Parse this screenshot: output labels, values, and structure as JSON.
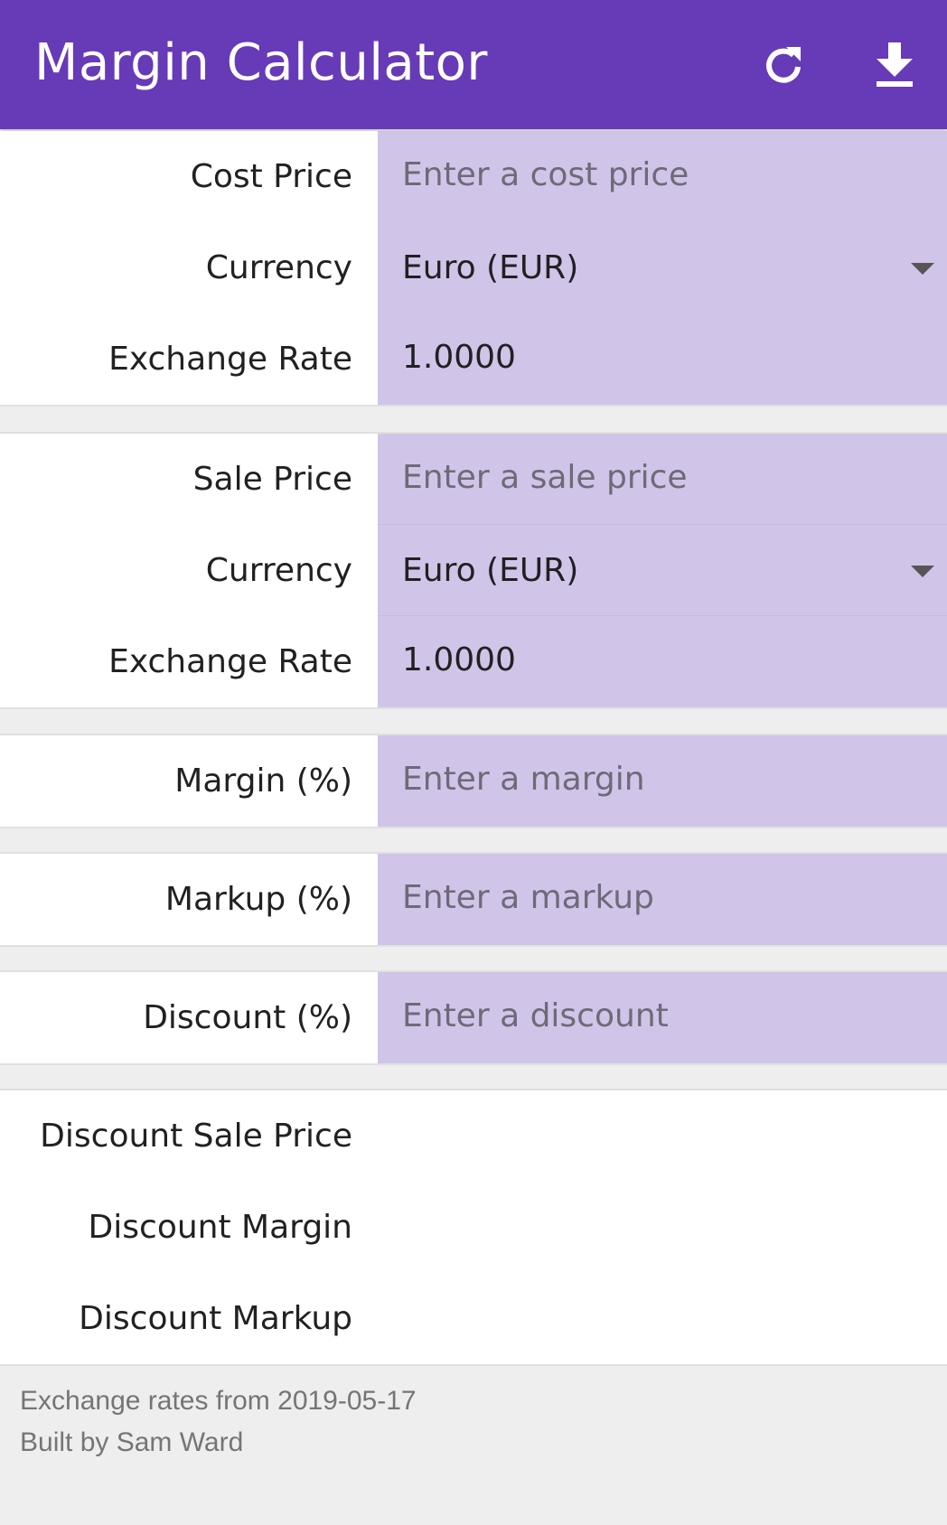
{
  "app": {
    "title": "Margin Calculator",
    "refresh_icon": "refresh-icon",
    "download_icon": "download-icon",
    "colors": {
      "primary": "#673ab7",
      "input_bg": "#d1c4e9",
      "page_bg": "#eeeeee"
    }
  },
  "cost": {
    "price_label": "Cost Price",
    "price_placeholder": "Enter a cost price",
    "currency_label": "Currency",
    "currency_value": "Euro (EUR)",
    "rate_label": "Exchange Rate",
    "rate_value": "1.0000"
  },
  "sale": {
    "price_label": "Sale Price",
    "price_placeholder": "Enter a sale price",
    "currency_label": "Currency",
    "currency_value": "Euro (EUR)",
    "rate_label": "Exchange Rate",
    "rate_value": "1.0000"
  },
  "margin": {
    "label": "Margin (%)",
    "placeholder": "Enter a margin"
  },
  "markup": {
    "label": "Markup (%)",
    "placeholder": "Enter a markup"
  },
  "discount": {
    "label": "Discount (%)",
    "placeholder": "Enter a discount"
  },
  "results": {
    "discount_sale_price_label": "Discount Sale Price",
    "discount_margin_label": "Discount Margin",
    "discount_markup_label": "Discount Markup"
  },
  "footer": {
    "rates_text": "Exchange rates from 2019-05-17",
    "credit_text": "Built by Sam Ward"
  }
}
